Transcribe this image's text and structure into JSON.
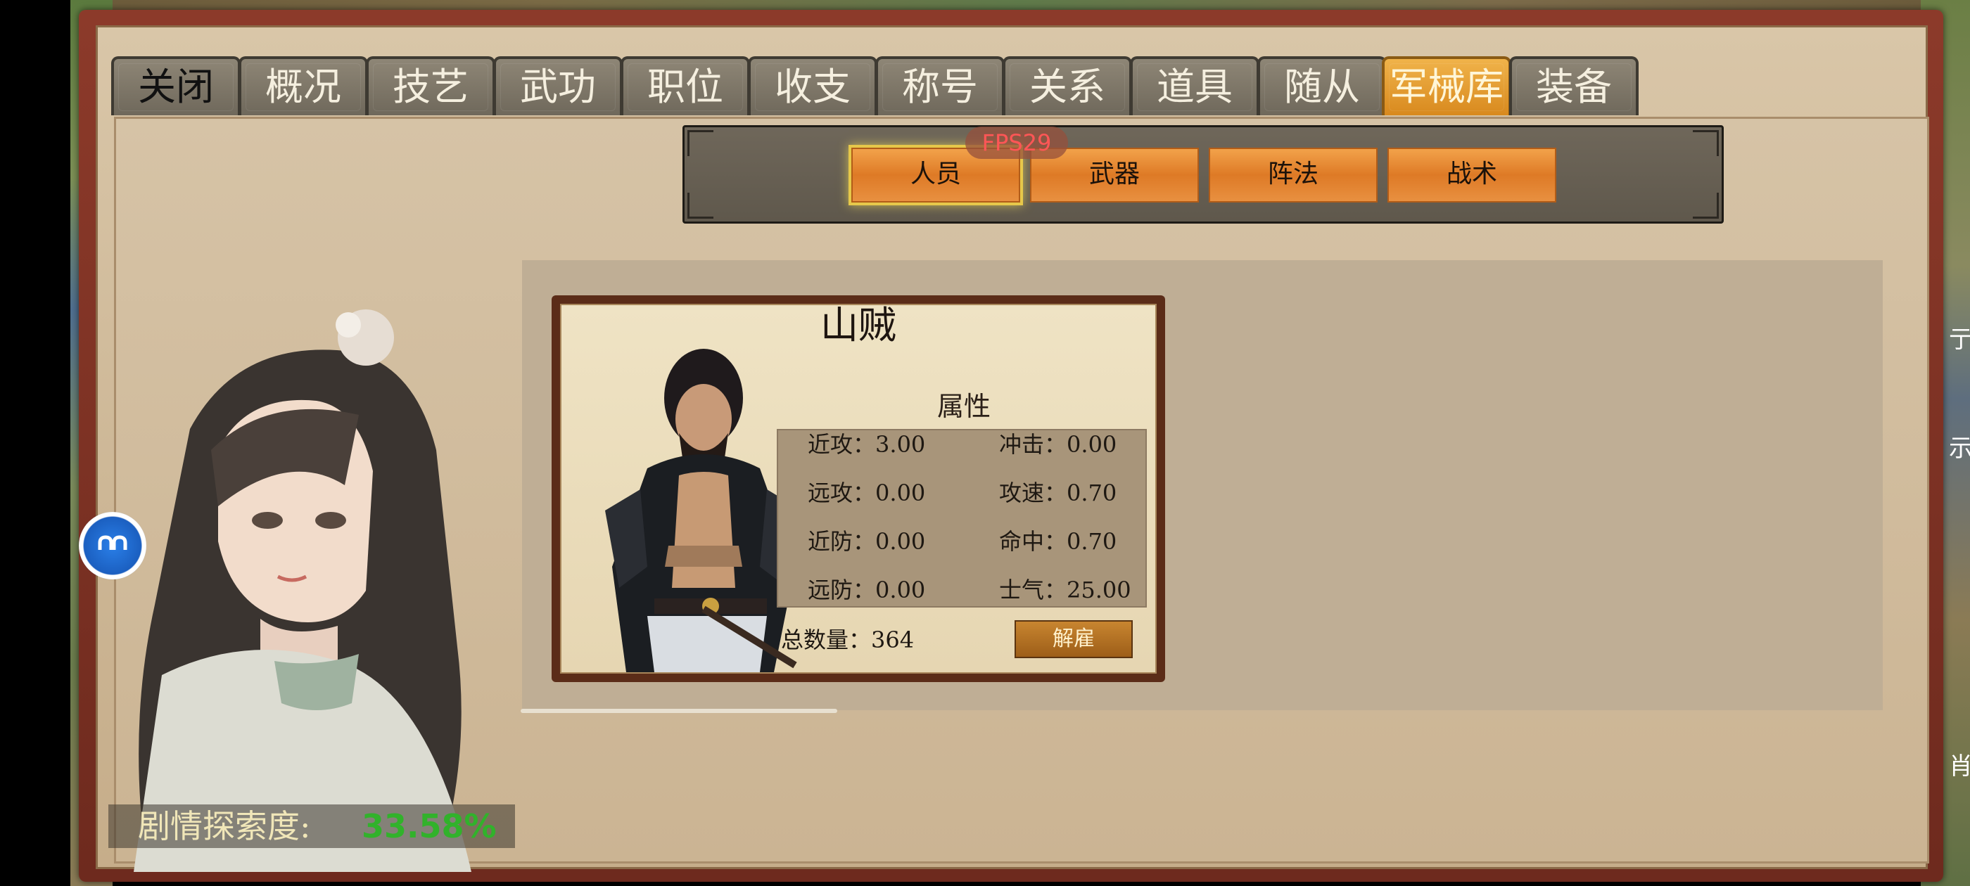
{
  "tabs": [
    {
      "label": "关闭",
      "active": false
    },
    {
      "label": "概况",
      "active": false
    },
    {
      "label": "技艺",
      "active": false
    },
    {
      "label": "武功",
      "active": false
    },
    {
      "label": "职位",
      "active": false
    },
    {
      "label": "收支",
      "active": false
    },
    {
      "label": "称号",
      "active": false
    },
    {
      "label": "关系",
      "active": false
    },
    {
      "label": "道具",
      "active": false
    },
    {
      "label": "随从",
      "active": false
    },
    {
      "label": "军械库",
      "active": true
    },
    {
      "label": "装备",
      "active": false
    }
  ],
  "subnav": {
    "items": [
      {
        "label": "人员",
        "active": true
      },
      {
        "label": "武器",
        "active": false
      },
      {
        "label": "阵法",
        "active": false
      },
      {
        "label": "战术",
        "active": false
      }
    ]
  },
  "fps": "FPS29",
  "unit_card": {
    "name": "山贼",
    "section_label": "属性",
    "attributes": [
      {
        "label": "近攻",
        "value": "3.00"
      },
      {
        "label": "冲击",
        "value": "0.00"
      },
      {
        "label": "远攻",
        "value": "0.00"
      },
      {
        "label": "攻速",
        "value": "0.70"
      },
      {
        "label": "近防",
        "value": "0.00"
      },
      {
        "label": "命中",
        "value": "0.70"
      },
      {
        "label": "远防",
        "value": "0.00"
      },
      {
        "label": "士气",
        "value": "25.00"
      }
    ],
    "count_label": "总数量",
    "count_value": "364",
    "dismiss_label": "解雇"
  },
  "story_progress": {
    "label": "剧情探索度:",
    "value": "33.58%"
  },
  "edge_glyphs": [
    "亍",
    "示",
    "肖"
  ],
  "colors": {
    "active_tab": "#e9a33a",
    "progress_value": "#31b22b",
    "fps_text": "#ff5656"
  }
}
